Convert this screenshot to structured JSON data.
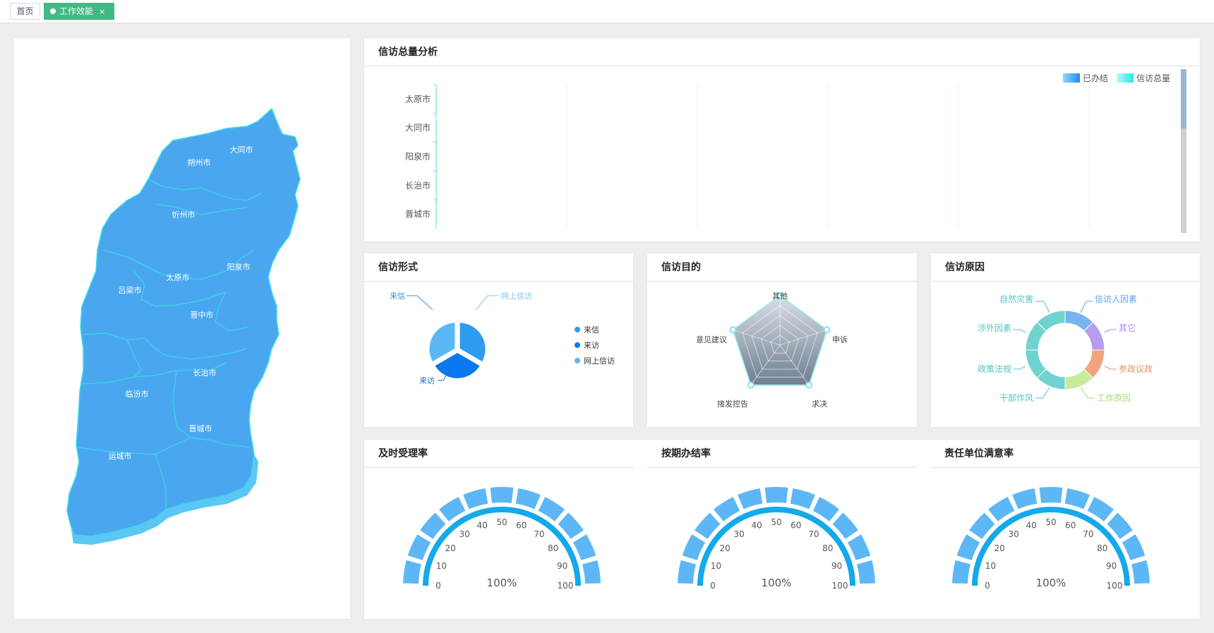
{
  "tabs": {
    "home_label": "首页",
    "active_label": "工作效能",
    "close_glyph": "×"
  },
  "map": {
    "cities": [
      "大同市",
      "朔州市",
      "忻州市",
      "阳泉市",
      "太原市",
      "吕梁市",
      "晋中市",
      "长治市",
      "临汾市",
      "晋城市",
      "运城市"
    ],
    "fill_color": "#4aa7ef",
    "border_color": "#35e0e6"
  },
  "total_analysis": {
    "title": "信访总量分析",
    "legend": [
      "已办结",
      "信访总量"
    ],
    "categories": [
      "太原市",
      "大同市",
      "阳泉市",
      "长治市",
      "晋城市"
    ]
  },
  "forms": {
    "title": "信访形式",
    "legend": [
      "来信",
      "来访",
      "网上信访"
    ],
    "colors": [
      "#2f9bef",
      "#0a78f0",
      "#5cb8f5"
    ]
  },
  "purpose": {
    "title": "信访目的",
    "indicators": [
      "其他",
      "申诉",
      "求决",
      "接发控告",
      "意见建议"
    ]
  },
  "reasons": {
    "title": "信访原因",
    "labels": [
      "信访人因素",
      "其它",
      "参政议政",
      "工作原因",
      "干部作风",
      "政策法规",
      "涉外因素",
      "自然灾害"
    ],
    "colors": [
      "#79b3f0",
      "#b79cf1",
      "#f0a37d",
      "#c8eb9c",
      "#6fd3cf",
      "#6fd3cf",
      "#6fd3cf",
      "#6fd3cf"
    ]
  },
  "gauges": [
    {
      "title": "及时受理率",
      "value": 100,
      "label": "100%"
    },
    {
      "title": "按期办结率",
      "value": 100,
      "label": "100%"
    },
    {
      "title": "责任单位满意率",
      "value": 100,
      "label": "100%"
    }
  ],
  "gauge_ticks": [
    "0",
    "10",
    "20",
    "30",
    "40",
    "50",
    "60",
    "70",
    "80",
    "90",
    "100"
  ],
  "chart_data": [
    {
      "type": "bar",
      "title": "信访总量分析",
      "categories": [
        "太原市",
        "大同市",
        "阳泉市",
        "长治市",
        "晋城市"
      ],
      "series": [
        {
          "name": "已办结",
          "values": []
        },
        {
          "name": "信访总量",
          "values": []
        }
      ],
      "orientation": "horizontal",
      "legend": "top-right",
      "grid": true
    },
    {
      "type": "pie",
      "title": "信访形式",
      "categories": [
        "来信",
        "来访",
        "网上信访"
      ],
      "values": [
        1,
        1,
        1
      ],
      "legend": "right"
    },
    {
      "type": "radar",
      "title": "信访目的",
      "indicators": [
        "其他",
        "申诉",
        "求决",
        "接发控告",
        "意见建议"
      ]
    },
    {
      "type": "pie",
      "title": "信访原因",
      "categories": [
        "信访人因素",
        "其它",
        "参政议政",
        "工作原因",
        "干部作风",
        "政策法规",
        "涉外因素",
        "自然灾害"
      ],
      "values": [
        1,
        1,
        1,
        1,
        1,
        1,
        1,
        1
      ]
    },
    {
      "type": "gauge",
      "title": "及时受理率",
      "value": 100,
      "range": [
        0,
        100
      ]
    },
    {
      "type": "gauge",
      "title": "按期办结率",
      "value": 100,
      "range": [
        0,
        100
      ]
    },
    {
      "type": "gauge",
      "title": "责任单位满意率",
      "value": 100,
      "range": [
        0,
        100
      ]
    }
  ]
}
